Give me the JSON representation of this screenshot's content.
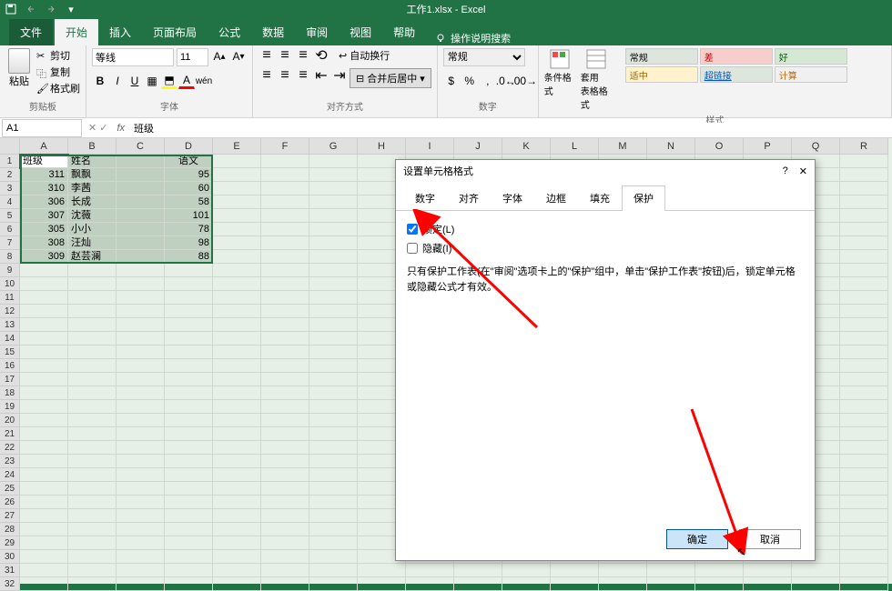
{
  "app": {
    "title": "工作1.xlsx - Excel"
  },
  "tabs": {
    "file": "文件",
    "home": "开始",
    "insert": "插入",
    "layout": "页面布局",
    "formula": "公式",
    "data": "数据",
    "review": "审阅",
    "view": "视图",
    "help": "帮助",
    "tell_me": "操作说明搜索"
  },
  "ribbon": {
    "clipboard": {
      "label": "剪贴板",
      "paste": "粘贴",
      "cut": "剪切",
      "copy": "复制",
      "painter": "格式刷"
    },
    "font": {
      "label": "字体",
      "name": "等线",
      "size": "11"
    },
    "align": {
      "label": "对齐方式",
      "wrap": "自动换行",
      "merge": "合并后居中"
    },
    "number": {
      "label": "数字",
      "format": "常规"
    },
    "styles": {
      "label": "样式",
      "cond": "条件格式",
      "table": "套用\n表格格式",
      "normal": "常规",
      "bad": "差",
      "good": "好",
      "neutral": "适中",
      "link": "超链接",
      "calc": "计算"
    }
  },
  "formula_bar": {
    "name_box": "A1",
    "formula": "班级"
  },
  "columns": [
    "A",
    "B",
    "C",
    "D",
    "E",
    "F",
    "G",
    "H",
    "I",
    "J",
    "K",
    "L",
    "M",
    "N",
    "O",
    "P",
    "Q",
    "R"
  ],
  "table": {
    "headers": [
      "班级",
      "姓名",
      "",
      "语文"
    ],
    "rows": [
      [
        "311",
        "飘飘",
        "",
        "95"
      ],
      [
        "310",
        "李茜",
        "",
        "60"
      ],
      [
        "306",
        "长成",
        "",
        "58"
      ],
      [
        "307",
        "沈薇",
        "",
        "101"
      ],
      [
        "305",
        "小小",
        "",
        "78"
      ],
      [
        "308",
        "汪灿",
        "",
        "98"
      ],
      [
        "309",
        "赵芸澜",
        "",
        "88"
      ]
    ]
  },
  "dialog": {
    "title": "设置单元格格式",
    "tabs": [
      "数字",
      "对齐",
      "字体",
      "边框",
      "填充",
      "保护"
    ],
    "locked": "锁定(L)",
    "hidden": "隐藏(I)",
    "note": "只有保护工作表(在\"审阅\"选项卡上的\"保护\"组中，单击\"保护工作表\"按钮)后，锁定单元格或隐藏公式才有效。",
    "ok": "确定",
    "cancel": "取消",
    "help": "?",
    "close": "✕"
  }
}
